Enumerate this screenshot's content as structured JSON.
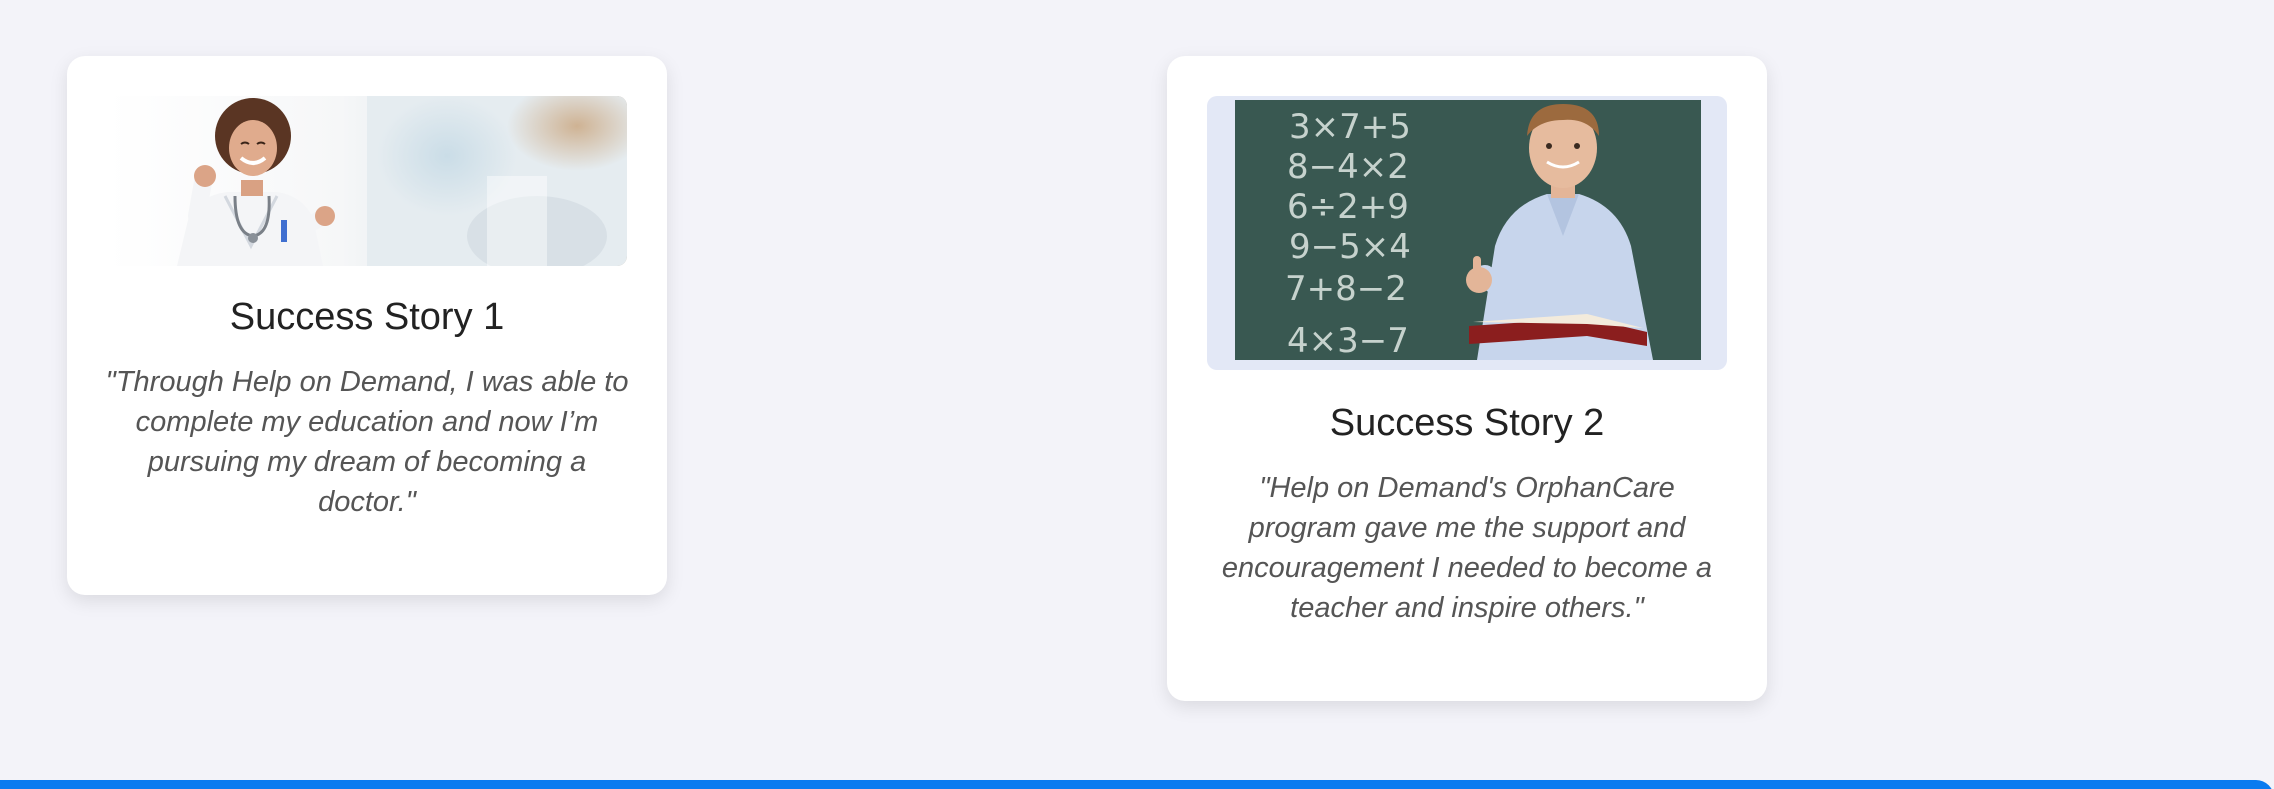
{
  "stories": [
    {
      "title": "Success Story 1",
      "quote": "\"Through Help on Demand, I was able to complete my education and now I’m pursuing my dream of becoming a doctor.\""
    },
    {
      "title": "Success Story 2",
      "quote": "\"Help on Demand's OrphanCare program gave me the support and encouragement I needed to become a teacher and inspire others.\""
    }
  ],
  "chalkboard_lines": [
    "3×7+5",
    "8−4×2",
    "6÷2+9",
    "9−5×4",
    "7+8−2",
    "4×3−7"
  ],
  "colors": {
    "background": "#f3f3f9",
    "card": "#ffffff",
    "accent_bar": "#0a7bf0",
    "chalkboard": "#3d5d55"
  }
}
